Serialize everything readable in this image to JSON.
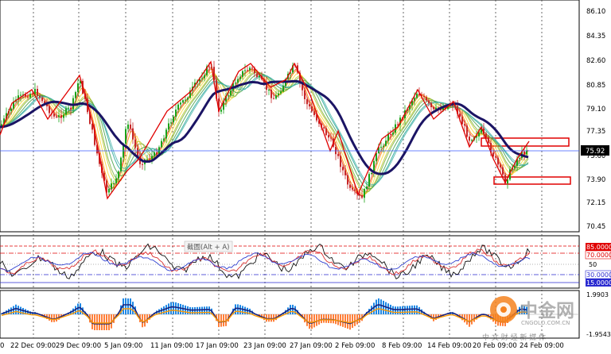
{
  "price_pane": {
    "price_labels": [
      "86.10",
      "84.35",
      "82.60",
      "80.85",
      "79.10",
      "77.35",
      "75.60",
      "73.90",
      "72.15",
      "70.45"
    ],
    "current_price": "75.92"
  },
  "oscillator_pane": {
    "watermark": "截圖(Alt + A)",
    "levels": [
      "85.0000",
      "70.0000",
      "50",
      "30.0000",
      "15.0000"
    ]
  },
  "macd_pane": {
    "labels": [
      "1.9903",
      "-1.9543"
    ]
  },
  "time_axis": {
    "labels": [
      "0",
      "22 Dec 09:00",
      "29 Dec 09:00",
      "5 Jan 09:00",
      "11 Jan 09:00",
      "17 Jan 09:00",
      "23 Jan 09:00",
      "27 Jan 09:00",
      "2 Feb 09:00",
      "8 Feb 09:00",
      "14 Feb 09:00",
      "20 Feb 09:00",
      "24 Feb 09:00"
    ]
  },
  "logo": {
    "brand": "中金网",
    "tagline": "中 文 财 经 新 媒 体",
    "url": "CNGOLD.COM.CN"
  },
  "colors": {
    "candle_bull": "#1aa318",
    "candle_bear": "#c62828",
    "ma_main": "#1b1464",
    "zigzag": "#e00000",
    "price_line": "#3b5bff",
    "macd_pos": "#1e88e5",
    "macd_neg": "#ff7f3a",
    "logo_orange": "#f5821f"
  }
}
